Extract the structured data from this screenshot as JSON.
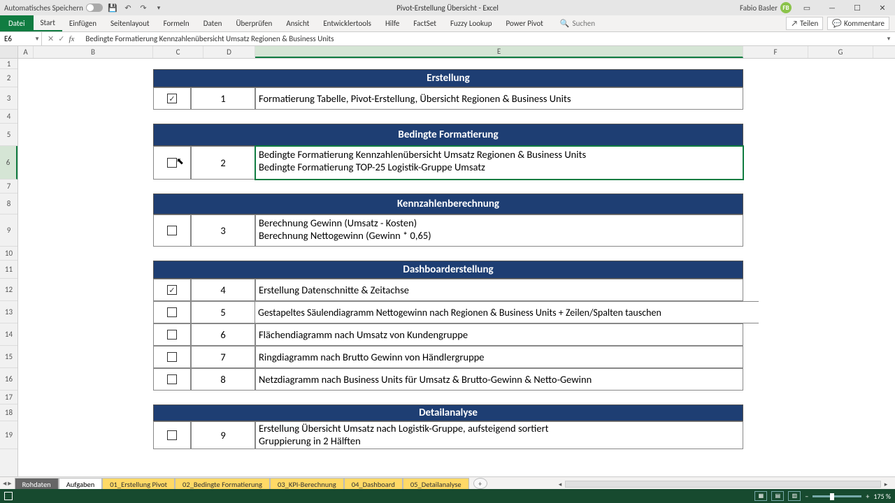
{
  "titlebar": {
    "autosave_label": "Automatisches Speichern",
    "doc_title": "Pivot-Erstellung Übersicht  -  Excel",
    "user_name": "Fabio Basler",
    "user_initials": "FB"
  },
  "ribbon": {
    "tabs": [
      "Datei",
      "Start",
      "Einfügen",
      "Seitenlayout",
      "Formeln",
      "Daten",
      "Überprüfen",
      "Ansicht",
      "Entwicklertools",
      "Hilfe",
      "FactSet",
      "Fuzzy Lookup",
      "Power Pivot"
    ],
    "search_placeholder": "Suchen",
    "share_label": "Teilen",
    "comments_label": "Kommentare"
  },
  "fxbar": {
    "cell_ref": "E6",
    "formula": "Bedingte Formatierung Kennzahlenübersicht Umsatz Regionen & Business Units"
  },
  "columns": [
    "A",
    "B",
    "C",
    "D",
    "E",
    "F",
    "G"
  ],
  "rows": [
    "1",
    "2",
    "3",
    "4",
    "5",
    "6",
    "7",
    "8",
    "9",
    "10",
    "11",
    "12",
    "13",
    "14",
    "15",
    "16",
    "17",
    "18",
    "19"
  ],
  "sections": {
    "s1": {
      "title": "Erstellung",
      "items": [
        {
          "num": "1",
          "checked": true,
          "text": "Formatierung Tabelle, Pivot-Erstellung, Übersicht Regionen & Business Units"
        }
      ]
    },
    "s2": {
      "title": "Bedingte Formatierung",
      "items": [
        {
          "num": "2",
          "checked": false,
          "line1": "Bedingte Formatierung Kennzahlenübersicht Umsatz Regionen & Business Units",
          "line2": "Bedingte Formatierung TOP-25 Logistik-Gruppe Umsatz"
        }
      ]
    },
    "s3": {
      "title": "Kennzahlenberechnung",
      "items": [
        {
          "num": "3",
          "checked": false,
          "line1": "Berechnung Gewinn (Umsatz - Kosten)",
          "line2": "Berechnung Nettogewinn (Gewinn * 0,65)"
        }
      ]
    },
    "s4": {
      "title": "Dashboarderstellung",
      "items": [
        {
          "num": "4",
          "checked": true,
          "text": "Erstellung Datenschnitte & Zeitachse"
        },
        {
          "num": "5",
          "checked": false,
          "text": "Gestapeltes Säulendiagramm Nettogewinn nach Regionen & Business Units + Zeilen/Spalten tauschen"
        },
        {
          "num": "6",
          "checked": false,
          "text": "Flächendiagramm nach Umsatz von Kundengruppe"
        },
        {
          "num": "7",
          "checked": false,
          "text": "Ringdiagramm nach Brutto Gewinn von Händlergruppe"
        },
        {
          "num": "8",
          "checked": false,
          "text": "Netzdiagramm nach Business Units für Umsatz & Brutto-Gewinn & Netto-Gewinn"
        }
      ]
    },
    "s5": {
      "title": "Detailanalyse",
      "items": [
        {
          "num": "9",
          "checked": false,
          "line1": "Erstellung Übersicht Umsatz nach Logistik-Gruppe, aufsteigend sortiert",
          "line2": "Gruppierung in 2 Hälften"
        }
      ]
    }
  },
  "sheets": [
    "Rohdaten",
    "Aufgaben",
    "01_Erstellung Pivot",
    "02_Bedingte Formatierung",
    "03_KPI-Berechnung",
    "04_Dashboard",
    "05_Detailanalyse"
  ],
  "statusbar": {
    "zoom": "175 %"
  }
}
